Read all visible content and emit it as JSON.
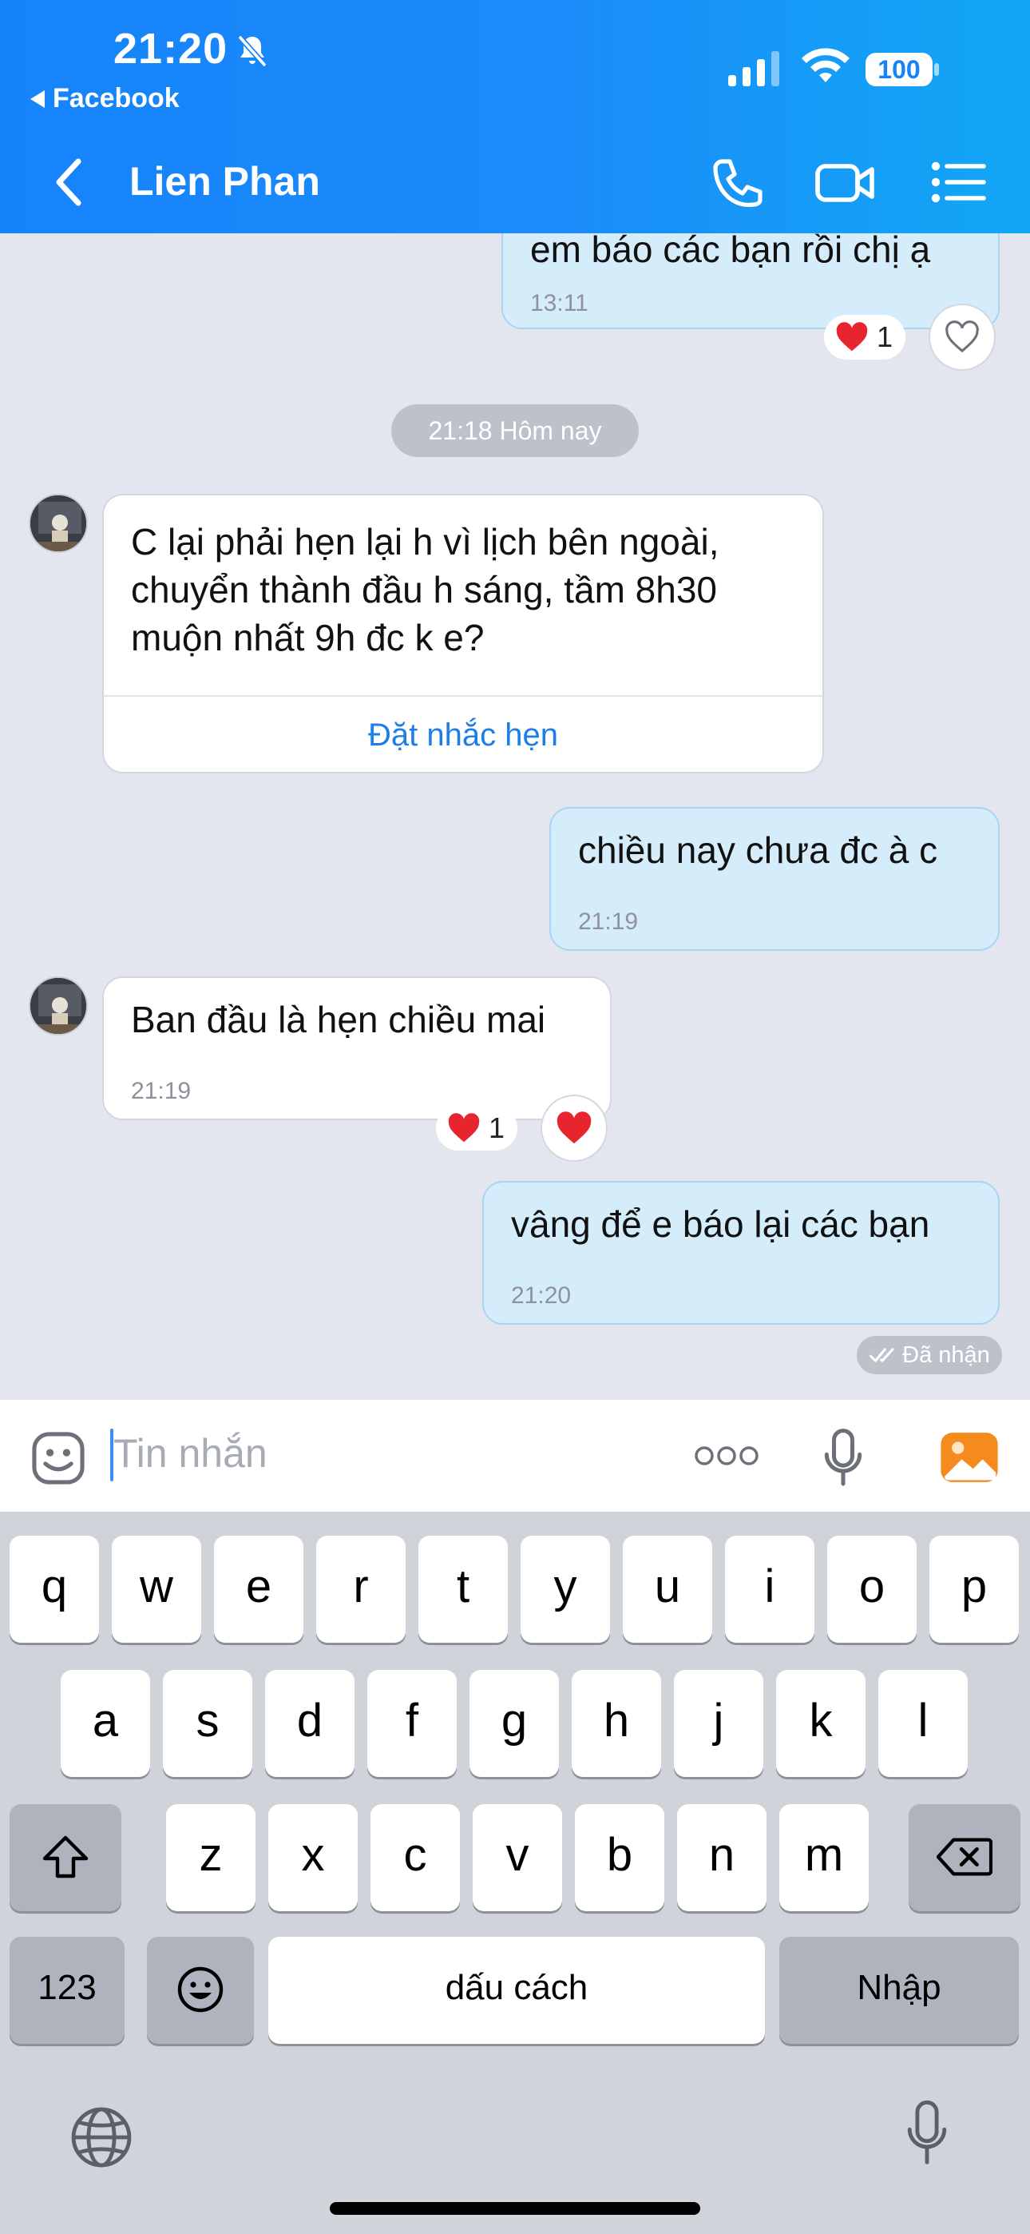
{
  "status_bar": {
    "time": "21:20",
    "back_app": "Facebook",
    "battery": "100"
  },
  "header": {
    "title": "Lien Phan"
  },
  "messages": {
    "m1": {
      "text": "em báo các bạn rồi chị ạ",
      "time": "13:11",
      "reaction": "❤️",
      "reaction_count": "1"
    },
    "date_divider": "21:18 Hôm nay",
    "m2": {
      "lines": [
        "C lại phải hẹn lại h vì lịch bên ngoài,",
        "chuyển thành đầu h sáng, tầm 8h30",
        "muộn nhất 9h đc k e?"
      ],
      "action": "Đặt nhắc hẹn"
    },
    "m3": {
      "text": "chiều nay chưa đc à c",
      "time": "21:19"
    },
    "m4": {
      "text": "Ban đầu là hẹn chiều mai",
      "time": "21:19",
      "reaction": "❤️",
      "reaction_count": "1"
    },
    "m5": {
      "text": "vâng để e báo lại các bạn",
      "time": "21:20",
      "status": "Đã nhận"
    }
  },
  "input": {
    "placeholder": "Tin nhắn"
  },
  "keyboard": {
    "row1": [
      "q",
      "w",
      "e",
      "r",
      "t",
      "y",
      "u",
      "i",
      "o",
      "p"
    ],
    "row2": [
      "a",
      "s",
      "d",
      "f",
      "g",
      "h",
      "j",
      "k",
      "l"
    ],
    "row3": [
      "z",
      "x",
      "c",
      "v",
      "b",
      "n",
      "m"
    ],
    "numbers": "123",
    "space": "dấu cách",
    "return": "Nhập"
  },
  "colors": {
    "header_start": "#1683fb",
    "header_end": "#12a7f5",
    "outgoing_bubble": "#d5ecfb",
    "link": "#1d7ee8",
    "heart": "#e8242f"
  }
}
